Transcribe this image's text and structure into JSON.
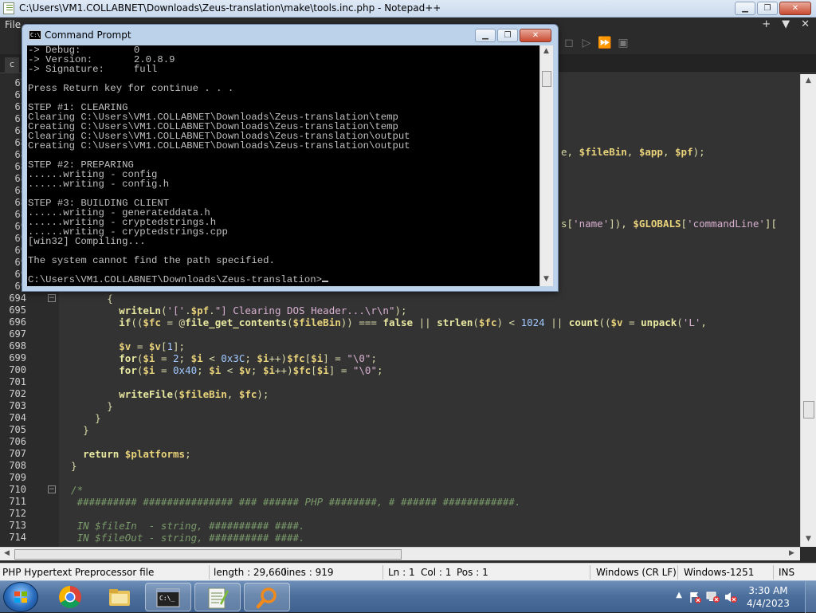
{
  "npp": {
    "title": "C:\\Users\\VM1.COLLABNET\\Downloads\\Zeus-translation\\make\\tools.inc.php - Notepad++",
    "menu_file": "File",
    "tab_label": "c",
    "line_numbers_hidden": [
      "67",
      "67",
      "67",
      "67",
      "68",
      "68",
      "68",
      "68",
      "68",
      "68",
      "68",
      "68",
      "69",
      "69",
      "69",
      "69",
      "69",
      "69"
    ],
    "behind_fragments": {
      "line_687": "e, $fileBin, $app, $pf);",
      "line_692": "s['name']), $GLOBALS['commandLine']["
    },
    "lines": [
      {
        "n": "694",
        "code": "        {"
      },
      {
        "n": "695",
        "code": "          writeLn('['.$pf.\"] Clearing DOS Header...\\r\\n\");"
      },
      {
        "n": "696",
        "code": "          if(($fc = @file_get_contents($fileBin)) === false || strlen($fc) < 1024 || count(($v = unpack('L',"
      },
      {
        "n": "697",
        "code": ""
      },
      {
        "n": "698",
        "code": "          $v = $v[1];"
      },
      {
        "n": "699",
        "code": "          for($i = 2; $i < 0x3C; $i++)$fc[$i] = \"\\0\";"
      },
      {
        "n": "700",
        "code": "          for($i = 0x40; $i < $v; $i++)$fc[$i] = \"\\0\";"
      },
      {
        "n": "701",
        "code": ""
      },
      {
        "n": "702",
        "code": "          writeFile($fileBin, $fc);"
      },
      {
        "n": "703",
        "code": "        }"
      },
      {
        "n": "704",
        "code": "      }"
      },
      {
        "n": "705",
        "code": "    }"
      },
      {
        "n": "706",
        "code": ""
      },
      {
        "n": "707",
        "code": "    return $platforms;"
      },
      {
        "n": "708",
        "code": "  }"
      },
      {
        "n": "709",
        "code": ""
      },
      {
        "n": "710",
        "code": "  /*"
      },
      {
        "n": "711",
        "code": "   ########## ############### ### ###### PHP ########, # ###### ############."
      },
      {
        "n": "712",
        "code": ""
      },
      {
        "n": "713",
        "code": "   IN $fileIn  - string, ########## ####."
      },
      {
        "n": "714",
        "code": "   IN $fileOut - string, ########## ####."
      }
    ],
    "status": {
      "file_type": "PHP Hypertext Preprocessor file",
      "length": "length : 29,660",
      "lines": "lines : 919",
      "ln": "Ln : 1",
      "col": "Col : 1",
      "pos": "Pos : 1",
      "eol": "Windows (CR LF)",
      "encoding": "Windows-1251",
      "mode": "INS"
    }
  },
  "cmd": {
    "title": "Command Prompt",
    "lines": [
      "-> Debug:         0",
      "-> Version:       2.0.8.9",
      "-> Signature:     full",
      "",
      "Press Return key for continue . . .",
      "",
      "STEP #1: CLEARING",
      "Clearing C:\\Users\\VM1.COLLABNET\\Downloads\\Zeus-translation\\temp",
      "Creating C:\\Users\\VM1.COLLABNET\\Downloads\\Zeus-translation\\temp",
      "Clearing C:\\Users\\VM1.COLLABNET\\Downloads\\Zeus-translation\\output",
      "Creating C:\\Users\\VM1.COLLABNET\\Downloads\\Zeus-translation\\output",
      "",
      "STEP #2: PREPARING",
      "......writing - config",
      "......writing - config.h",
      "",
      "STEP #3: BUILDING CLIENT",
      "......writing - generateddata.h",
      "......writing - cryptedstrings.h",
      "......writing - cryptedstrings.cpp",
      "[win32] Compiling...",
      "",
      "The system cannot find the path specified.",
      "",
      "C:\\Users\\VM1.COLLABNET\\Downloads\\Zeus-translation>"
    ]
  },
  "taskbar": {
    "time": "3:30 AM",
    "date": "4/4/2023",
    "apps": [
      "start-button",
      "chrome",
      "explorer",
      "cmd",
      "notepad-plus-plus",
      "search-tool"
    ]
  },
  "colors": {
    "editor_bg": "#333333",
    "gutter_bg": "#2b2b2b",
    "code_text": "#dcdcaa",
    "console_bg": "#000000",
    "console_text": "#c0c0c0"
  }
}
